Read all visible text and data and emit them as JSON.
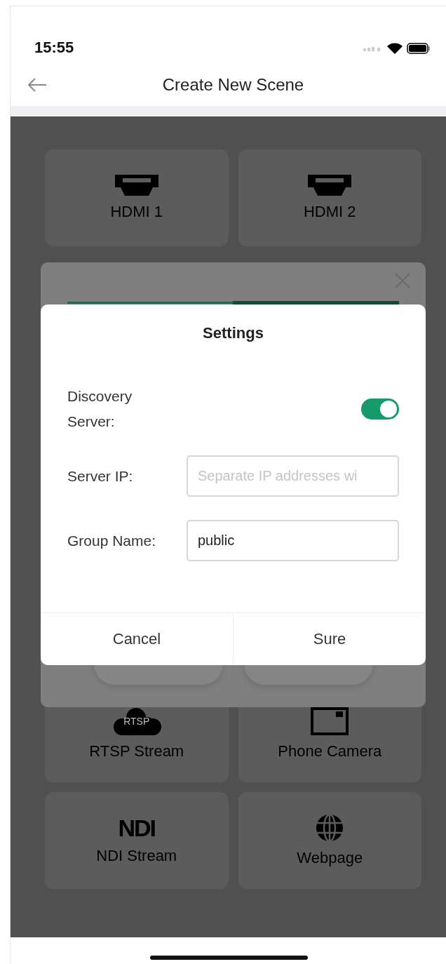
{
  "status_bar": {
    "time": "15:55"
  },
  "nav": {
    "title": "Create New Scene"
  },
  "sources_above": [
    {
      "label": "HDMI 1",
      "kind": "hdmi"
    },
    {
      "label": "HDMI 2",
      "kind": "hdmi"
    }
  ],
  "sources_below": [
    {
      "label": "RTSP Stream",
      "kind": "rtsp",
      "icon_text": "RTSP"
    },
    {
      "label": "Phone Camera",
      "kind": "camera"
    },
    {
      "label": "NDI Stream",
      "kind": "ndi",
      "icon_text": "NDI"
    },
    {
      "label": "Webpage",
      "kind": "web"
    }
  ],
  "settings": {
    "title": "Settings",
    "fields": [
      {
        "kind": "toggle",
        "label": "Discovery Server:",
        "on": true
      },
      {
        "kind": "text",
        "label": "Server IP:",
        "placeholder": "Separate IP addresses wi"
      },
      {
        "kind": "text",
        "label": "Group Name:",
        "value": "public"
      }
    ],
    "buttons": [
      "Cancel",
      "Sure"
    ]
  }
}
